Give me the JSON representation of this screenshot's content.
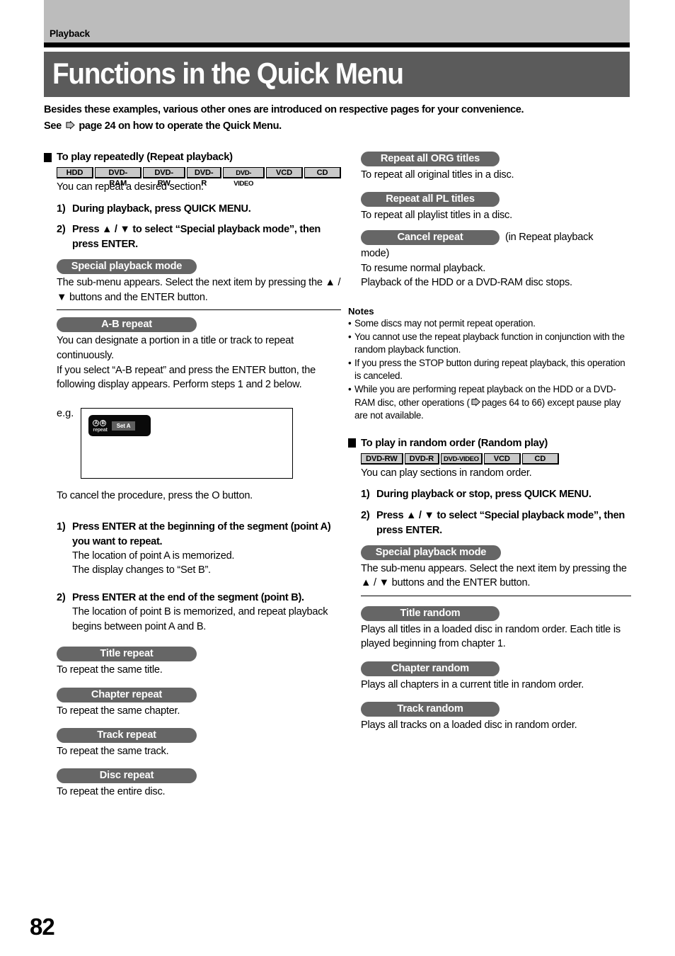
{
  "header": {
    "chapter_label": "Playback",
    "title": "Functions in the Quick Menu",
    "intro_line1": "Besides these examples, various other ones are introduced on respective pages for your convenience.",
    "intro_line2_before": "See",
    "intro_line2_after": "page 24 on how to operate the Quick Menu."
  },
  "page_number": "82",
  "colors": {
    "chapter_band": "#bcbcbc",
    "title_band": "#5b5b5b",
    "pill": "#666666",
    "badge_fill": "#c9c9c9",
    "osd_bg": "#0a0a0a",
    "osd_badge": "#5f5f5f"
  },
  "left": {
    "section": {
      "heading": "To play repeatedly (Repeat playback)",
      "badges": [
        "HDD",
        "DVD-RAM",
        "DVD-RW",
        "DVD-R",
        "DVD-VIDEO",
        "VCD",
        "CD"
      ],
      "lead": "You can repeat a desired section.",
      "steps": [
        {
          "num": "1)",
          "text": "During playback, press QUICK MENU."
        },
        {
          "num": "2)",
          "text": "Press ▲ / ▼ to select “Special playback mode”, then press ENTER."
        }
      ]
    },
    "special_mode": {
      "pill": "Special playback mode",
      "desc": "The sub-menu appears. Select the next item by pressing the ▲ / ▼ buttons and the ENTER button."
    },
    "ab_repeat": {
      "pill": "A-B repeat",
      "desc_line1": "You can designate a portion in a title or track to repeat continuously.",
      "desc_line2": "If you select “A-B repeat” and press the ENTER button, the following display appears. Perform steps 1 and 2 below.",
      "eg_label": "e.g.",
      "osd": {
        "circle_a": "A",
        "circle_b": "B",
        "repeat_label": "repeat",
        "set_label": "Set A"
      },
      "cancel_note": "To cancel the procedure, press the O button.",
      "steps": [
        {
          "num": "1)",
          "bold": "Press ENTER at the beginning of the segment (point A) you want to repeat.",
          "sub_line1": "The location of point A is memorized.",
          "sub_line2": "The display changes to “Set B”."
        },
        {
          "num": "2)",
          "bold": "Press ENTER at the end of the segment (point B).",
          "sub_line1": "The location of point B is memorized, and repeat playback begins between point A and B.",
          "sub_line2": ""
        }
      ]
    },
    "items": [
      {
        "pill": "Title repeat",
        "desc": "To repeat the same title."
      },
      {
        "pill": "Chapter repeat",
        "desc": "To repeat the same chapter."
      },
      {
        "pill": "Track repeat",
        "desc": "To repeat the same track."
      },
      {
        "pill": "Disc repeat",
        "desc": "To repeat the entire disc."
      }
    ]
  },
  "right": {
    "items_top": [
      {
        "pill": "Repeat all ORG titles",
        "desc": "To repeat all original titles in a disc."
      },
      {
        "pill": "Repeat all PL titles",
        "desc": "To repeat all playlist titles in a disc."
      }
    ],
    "cancel_repeat": {
      "pill": "Cancel repeat",
      "trail": "(in Repeat playback",
      "line2": "mode)",
      "line3": "To resume normal playback.",
      "line4": "Playback of the HDD or a DVD-RAM disc stops."
    },
    "notes": {
      "title": "Notes",
      "items": [
        "Some discs may not permit repeat operation.",
        "You cannot use the repeat playback function in conjunction with the random playback function.",
        "If you press the STOP button during repeat playback, this operation is canceled."
      ],
      "last_note_before": "While you are performing repeat playback on the HDD or a DVD-RAM disc, other operations (",
      "last_note_after": "pages 64 to 66) except pause play are not available."
    },
    "section": {
      "heading": "To play in random order (Random play)",
      "badges": [
        "DVD-RW",
        "DVD-R",
        "DVD-VIDEO",
        "VCD",
        "CD"
      ],
      "lead": "You can play sections in random order.",
      "steps": [
        {
          "num": "1)",
          "text": "During playback or stop, press QUICK MENU."
        },
        {
          "num": "2)",
          "text": "Press ▲ / ▼ to select “Special playback mode”, then press ENTER."
        }
      ]
    },
    "special_mode": {
      "pill": "Special playback mode",
      "desc": "The sub-menu appears. Select the next item by pressing the ▲ / ▼ buttons and the ENTER button."
    },
    "items_bottom": [
      {
        "pill": "Title random",
        "desc": "Plays all titles in a loaded disc in random order. Each title is played beginning from chapter 1."
      },
      {
        "pill": "Chapter random",
        "desc": "Plays all chapters in a current title in random order."
      },
      {
        "pill": "Track random",
        "desc": "Plays all tracks on a loaded disc in random order."
      }
    ]
  }
}
